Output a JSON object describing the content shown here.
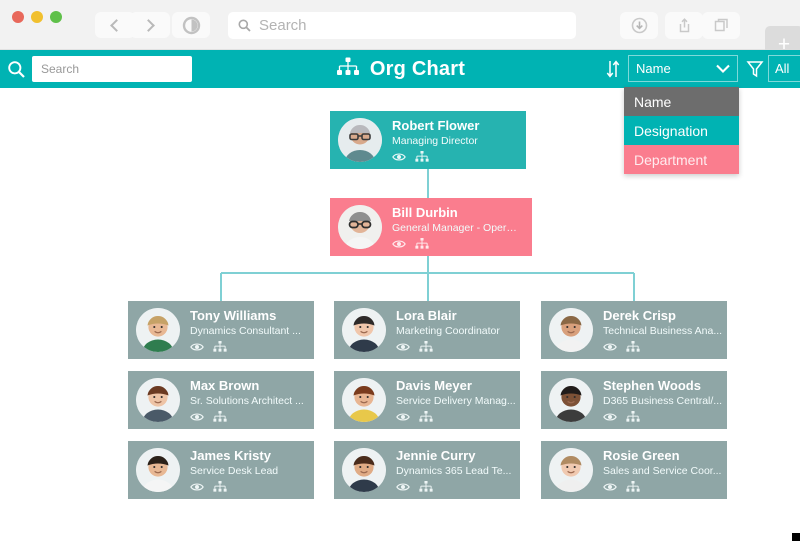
{
  "browser": {
    "search_placeholder": "Search",
    "back_icon": "chevron-left-icon",
    "forward_icon": "chevron-right-icon",
    "sidebar_icon": "reader-view-icon",
    "download_icon": "download-icon",
    "share_icon": "share-icon",
    "tabs_icon": "tabs-icon",
    "new_tab_label": "+"
  },
  "appbar": {
    "search_placeholder": "Search",
    "search_icon": "search-icon",
    "title": "Org Chart",
    "title_icon": "org-chart-icon",
    "sort_icon": "sort-icon",
    "sort_field": "Name",
    "chevron_icon": "chevron-down-icon",
    "filter_icon": "filter-icon",
    "filter_value": "All",
    "accent_color": "#00b3b3"
  },
  "dropdown": {
    "options": [
      {
        "label": "Name",
        "color": "#6d6d6d",
        "selected": true
      },
      {
        "label": "Designation",
        "color": "#00b3b3",
        "selected": false
      },
      {
        "label": "Department",
        "color": "#fa7d8e",
        "selected": false
      }
    ]
  },
  "chart": {
    "view_icon": "eye-icon",
    "hierarchy_icon": "hierarchy-icon",
    "root": {
      "name": "Robert Flower",
      "role": "Managing Director",
      "color": "#26b3b0"
    },
    "manager": {
      "name": "Bill Durbin",
      "role": "General Manager - Opera...",
      "color": "#fa7d8e"
    },
    "team_color": "#8fa6a6",
    "team": [
      {
        "name": "Tony Williams",
        "role": "Dynamics Consultant ..."
      },
      {
        "name": "Lora Blair",
        "role": "Marketing Coordinator"
      },
      {
        "name": "Derek Crisp",
        "role": "Technical Business Ana..."
      },
      {
        "name": "Max Brown",
        "role": "Sr. Solutions Architect ..."
      },
      {
        "name": "Davis Meyer",
        "role": "Service Delivery Manag..."
      },
      {
        "name": "Stephen Woods",
        "role": "D365 Business Central/..."
      },
      {
        "name": "James Kristy",
        "role": "Service Desk Lead"
      },
      {
        "name": "Jennie Curry",
        "role": "Dynamics 365 Lead Te..."
      },
      {
        "name": "Rosie Green",
        "role": "Sales and Service Coor..."
      }
    ]
  }
}
